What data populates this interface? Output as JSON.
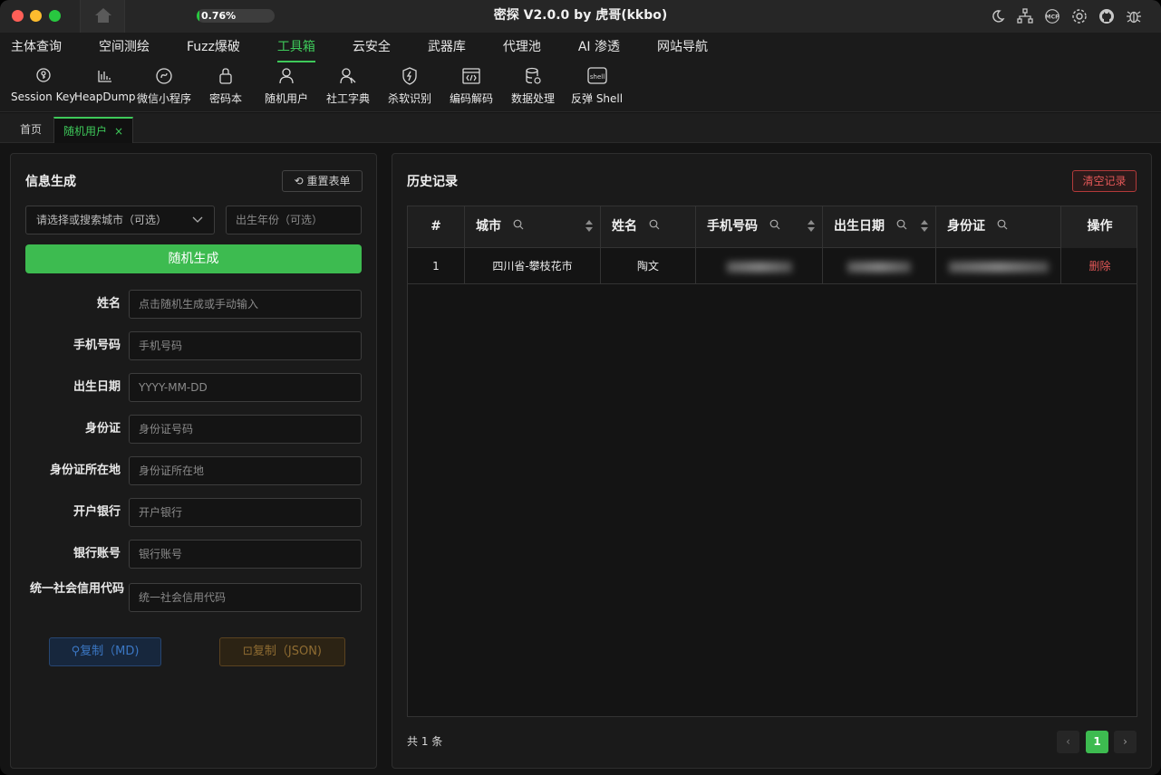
{
  "titlebar": {
    "title": "密探 V2.0.0 by 虎哥(kkbo)",
    "progress_text": "0.76%",
    "progress_value": 0.0076,
    "icons": [
      "moon-icon",
      "sitemap-icon",
      "mcp-icon",
      "gear-icon",
      "github-icon",
      "bug-icon"
    ],
    "mcp_label": "MCP"
  },
  "nav": {
    "items": [
      "主体查询",
      "空间测绘",
      "Fuzz爆破",
      "工具箱",
      "云安全",
      "武器库",
      "代理池",
      "AI 渗透",
      "网站导航"
    ],
    "active": "工具箱"
  },
  "toolbar": {
    "tools": [
      {
        "label": "Session Key",
        "icon": "key-icon"
      },
      {
        "label": "HeapDump",
        "icon": "heapdump-icon"
      },
      {
        "label": "微信小程序",
        "icon": "miniprogram-icon"
      },
      {
        "label": "密码本",
        "icon": "lock-icon"
      },
      {
        "label": "随机用户",
        "icon": "user-icon"
      },
      {
        "label": "社工字典",
        "icon": "users-icon"
      },
      {
        "label": "杀软识别",
        "icon": "shield-icon"
      },
      {
        "label": "编码解码",
        "icon": "code-icon"
      },
      {
        "label": "数据处理",
        "icon": "database-icon"
      },
      {
        "label": "反弹 Shell",
        "icon": "shell-icon"
      }
    ],
    "shell_badge": "shell"
  },
  "tabs": {
    "home": "首页",
    "active": "随机用户",
    "close": "×"
  },
  "left": {
    "title": "信息生成",
    "reset_label": "重置表单",
    "city_placeholder": "请选择或搜索城市（可选）",
    "year_placeholder": "出生年份（可选）",
    "generate_label": "随机生成",
    "fields": [
      {
        "label": "姓名",
        "placeholder": "点击随机生成或手动输入"
      },
      {
        "label": "手机号码",
        "placeholder": "手机号码"
      },
      {
        "label": "出生日期",
        "placeholder": "YYYY-MM-DD"
      },
      {
        "label": "身份证",
        "placeholder": "身份证号码"
      },
      {
        "label": "身份证所在地",
        "placeholder": "身份证所在地"
      },
      {
        "label": "开户银行",
        "placeholder": "开户银行"
      },
      {
        "label": "银行账号",
        "placeholder": "银行账号"
      },
      {
        "label": "统一社会信用代码",
        "placeholder": "统一社会信用代码"
      }
    ],
    "copy_md_label": "复制（MD)",
    "copy_json_label": "复制（JSON)"
  },
  "right": {
    "title": "历史记录",
    "clear_label": "清空记录",
    "columns": [
      "#",
      "城市",
      "姓名",
      "手机号码",
      "出生日期",
      "身份证",
      "操作"
    ],
    "rows": [
      {
        "index": "1",
        "city": "四川省-攀枝花市",
        "name": "陶文",
        "phone": "",
        "birth": "",
        "id": "",
        "action": "删除"
      }
    ],
    "total_text": "共 1 条",
    "page": "1",
    "prev": "‹",
    "next": "›"
  },
  "colors": {
    "accent": "#3ec95a",
    "danger": "#e25757",
    "background": "#141414"
  }
}
